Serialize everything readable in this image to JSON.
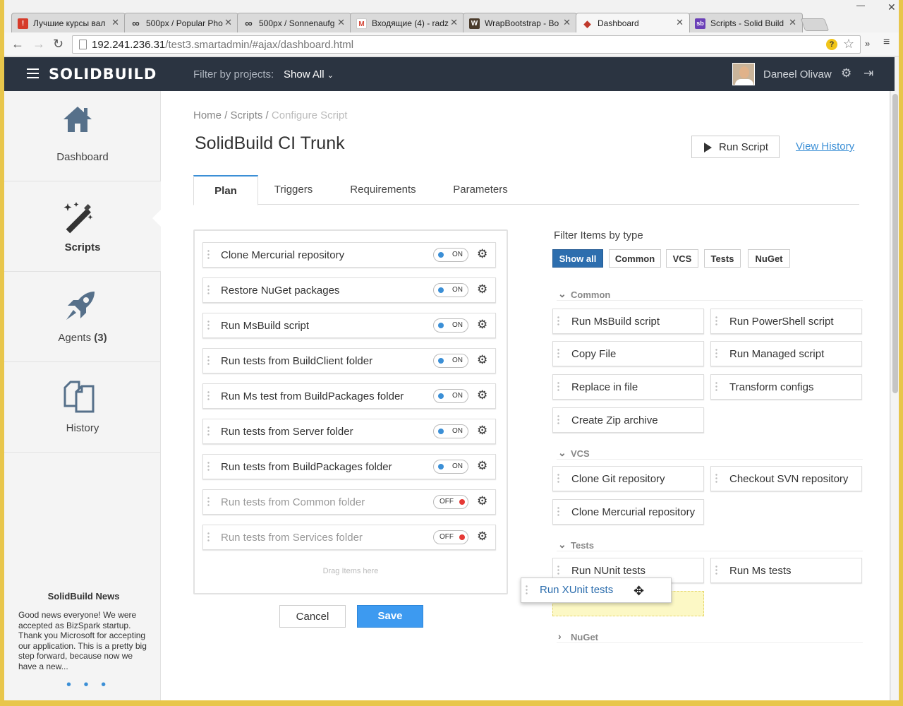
{
  "browser": {
    "tabs": [
      {
        "title": "Лучшие курсы вал",
        "fav": "!",
        "fav_color": "#d63b2a"
      },
      {
        "title": "500px / Popular Pho",
        "fav": "∞",
        "fav_color": "#444444"
      },
      {
        "title": "500px / Sonnenaufg",
        "fav": "∞",
        "fav_color": "#444444"
      },
      {
        "title": "Входящие (4) - radz",
        "fav": "M",
        "fav_color": "#d44638"
      },
      {
        "title": "WrapBootstrap - Bo",
        "fav": "W",
        "fav_color": "#4a3b2b"
      },
      {
        "title": "Dashboard",
        "fav": "◆",
        "fav_color": "#c0392b"
      },
      {
        "title": "Scripts - Solid Build",
        "fav": "sb",
        "fav_color": "#6a3fb7"
      }
    ],
    "active_tab": 5,
    "url_host": "192.241.236.31",
    "url_path": "/test3.smartadmin/#ajax/dashboard.html"
  },
  "header": {
    "brand": "SOLIDBUILD",
    "filter_label": "Filter by projects:",
    "filter_value": "Show All",
    "user_name": "Daneel Olivaw"
  },
  "sidebar": {
    "items": [
      {
        "label": "Dashboard",
        "icon": "home-icon"
      },
      {
        "label": "Scripts",
        "icon": "magic-wand-icon"
      },
      {
        "label": "Agents",
        "count": "(3)",
        "icon": "rocket-icon"
      },
      {
        "label": "History",
        "icon": "copy-icon"
      }
    ],
    "news_title": "SolidBuild News",
    "news_text": "Good news everyone! We were accepted as BizSpark startup. Thank you Microsoft for accepting our application. This is a pretty big step forward, because now we have a new...",
    "news_more": "• • •"
  },
  "main": {
    "breadcrumb": {
      "home": "Home",
      "scripts": "Scripts",
      "current": "Configure Script",
      "sep": "/"
    },
    "title": "SolidBuild CI Trunk",
    "run_label": "Run Script",
    "history_label": "View History",
    "tabs": [
      "Plan",
      "Triggers",
      "Requirements",
      "Parameters"
    ],
    "plan_items": [
      {
        "label": "Clone Mercurial repository",
        "state": "ON"
      },
      {
        "label": "Restore NuGet packages",
        "state": "ON"
      },
      {
        "label": "Run MsBuild script",
        "state": "ON"
      },
      {
        "label": "Run tests from BuildClient folder",
        "state": "ON"
      },
      {
        "label": "Run Ms test from BuildPackages folder",
        "state": "ON"
      },
      {
        "label": "Run tests from Server folder",
        "state": "ON"
      },
      {
        "label": "Run tests from BuildPackages folder",
        "state": "ON"
      },
      {
        "label": "Run tests from Common folder",
        "state": "OFF"
      },
      {
        "label": "Run tests from Services folder",
        "state": "OFF"
      }
    ],
    "drop_hint": "Drag Items here",
    "cancel_label": "Cancel",
    "save_label": "Save",
    "filter_title": "Filter Items by type",
    "filter_buttons": [
      "Show all",
      "Common",
      "VCS",
      "Tests",
      "NuGet"
    ],
    "groups": {
      "common": "Common",
      "vcs": "VCS",
      "tests": "Tests",
      "nuget": "NuGet"
    },
    "common_items": [
      "Run MsBuild script",
      "Run PowerShell script",
      "Copy File",
      "Run Managed script",
      "Replace in file",
      "Transform configs",
      "Create Zip archive"
    ],
    "vcs_items": [
      "Clone Git repository",
      "Checkout SVN repository",
      "Clone Mercurial repository"
    ],
    "tests_items": [
      "Run NUnit tests",
      "Run Ms tests"
    ],
    "dragging_item": "Run XUnit tests"
  },
  "colors": {
    "accent": "#3b8fd6",
    "header_bg": "#2b3441",
    "save": "#3d9af0",
    "off": "#e53935"
  }
}
